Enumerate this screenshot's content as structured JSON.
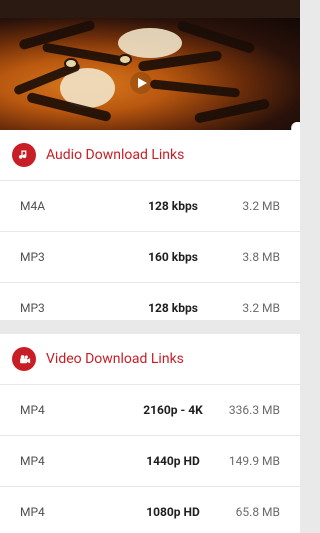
{
  "video_player": {
    "thumbnail_subject": "tiger face",
    "play_icon": "play-icon"
  },
  "audio_section": {
    "icon": "music-note-icon",
    "title": "Audio Download Links",
    "rows": [
      {
        "format": "M4A",
        "quality": "128 kbps",
        "size": "3.2 MB"
      },
      {
        "format": "MP3",
        "quality": "160 kbps",
        "size": "3.8 MB"
      },
      {
        "format": "MP3",
        "quality": "128 kbps",
        "size": "3.2 MB"
      }
    ]
  },
  "video_section": {
    "icon": "video-camera-icon",
    "title": "Video Download Links",
    "rows": [
      {
        "format": "MP4",
        "quality": "2160p - 4K",
        "size": "336.3 MB"
      },
      {
        "format": "MP4",
        "quality": "1440p HD",
        "size": "149.9 MB"
      },
      {
        "format": "MP4",
        "quality": "1080p HD",
        "size": "65.8 MB"
      }
    ]
  },
  "colors": {
    "accent": "#c81f26",
    "background": "#e9e9e9",
    "card": "#ffffff"
  }
}
